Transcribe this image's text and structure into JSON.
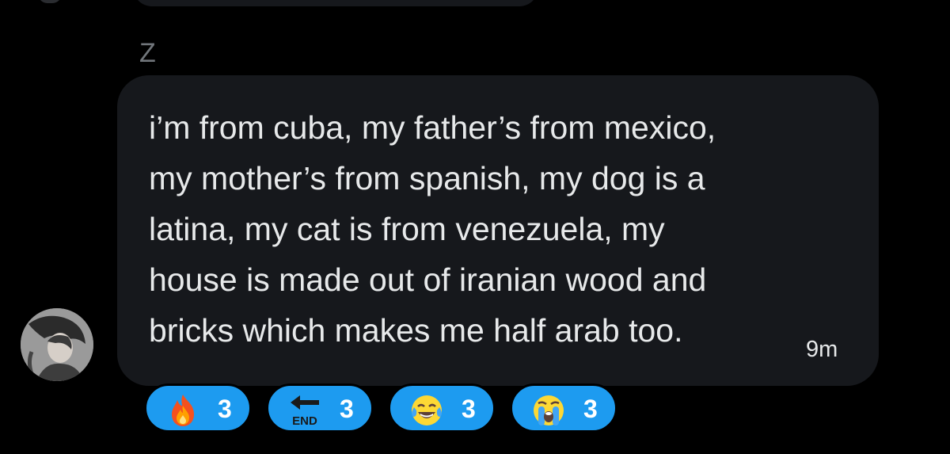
{
  "conversation": {
    "sender_name": "Z",
    "message": {
      "text": "i’m from cuba, my father’s from mexico,\nmy mother’s from spanish, my dog is a\nlatina, my cat is from venezuela, my\nhouse is made out of iranian wood and\nbricks which makes me half arab too.",
      "timestamp": "9m"
    },
    "reactions": [
      {
        "icon": "fire-emoji-icon",
        "count": "3"
      },
      {
        "icon": "end-arrow-emoji-icon",
        "count": "3",
        "icon_text": "END"
      },
      {
        "icon": "tears-of-joy-emoji-icon",
        "count": "3"
      },
      {
        "icon": "loudly-crying-emoji-icon",
        "count": "3"
      }
    ]
  },
  "colors": {
    "background": "#000000",
    "bubble": "#16181c",
    "text": "#e7e9ea",
    "muted": "#71767b",
    "reaction_pill": "#1d9bf0"
  }
}
